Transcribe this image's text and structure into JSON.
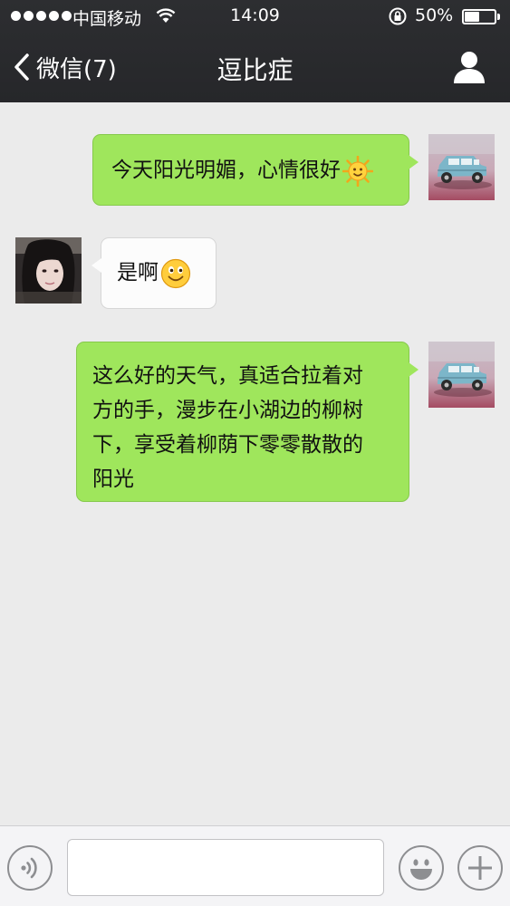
{
  "status_bar": {
    "carrier": "中国移动",
    "time": "14:09",
    "battery_percent": "50%",
    "battery_level": 0.5,
    "signal_bars": 5
  },
  "nav": {
    "back_label": "微信(7)",
    "title": "逗比症",
    "back_icon": "chevron-left-icon",
    "profile_icon": "person-icon"
  },
  "messages": [
    {
      "side": "right",
      "text": "今天阳光明媚，心情很好",
      "emoji": "sun-emoji",
      "avatar": "car-photo"
    },
    {
      "side": "left",
      "text": "是啊",
      "emoji": "smile-emoji",
      "avatar": "girl-photo"
    },
    {
      "side": "right",
      "lines": [
        "这么好的天气，真适合拉着对",
        "方的手，漫步在小湖边的柳树",
        "下，享受着柳荫下零零散散的",
        "阳光"
      ],
      "avatar": "car-photo"
    }
  ],
  "input_bar": {
    "voice_icon": "voice-icon",
    "text_value": "",
    "emoji_icon": "emoji-icon",
    "plus_icon": "plus-icon"
  },
  "colors": {
    "header_bg": "#2d2e31",
    "chat_bg": "#ebebeb",
    "outgoing_bubble": "#9fe65c",
    "incoming_bubble": "#fcfcfc"
  }
}
